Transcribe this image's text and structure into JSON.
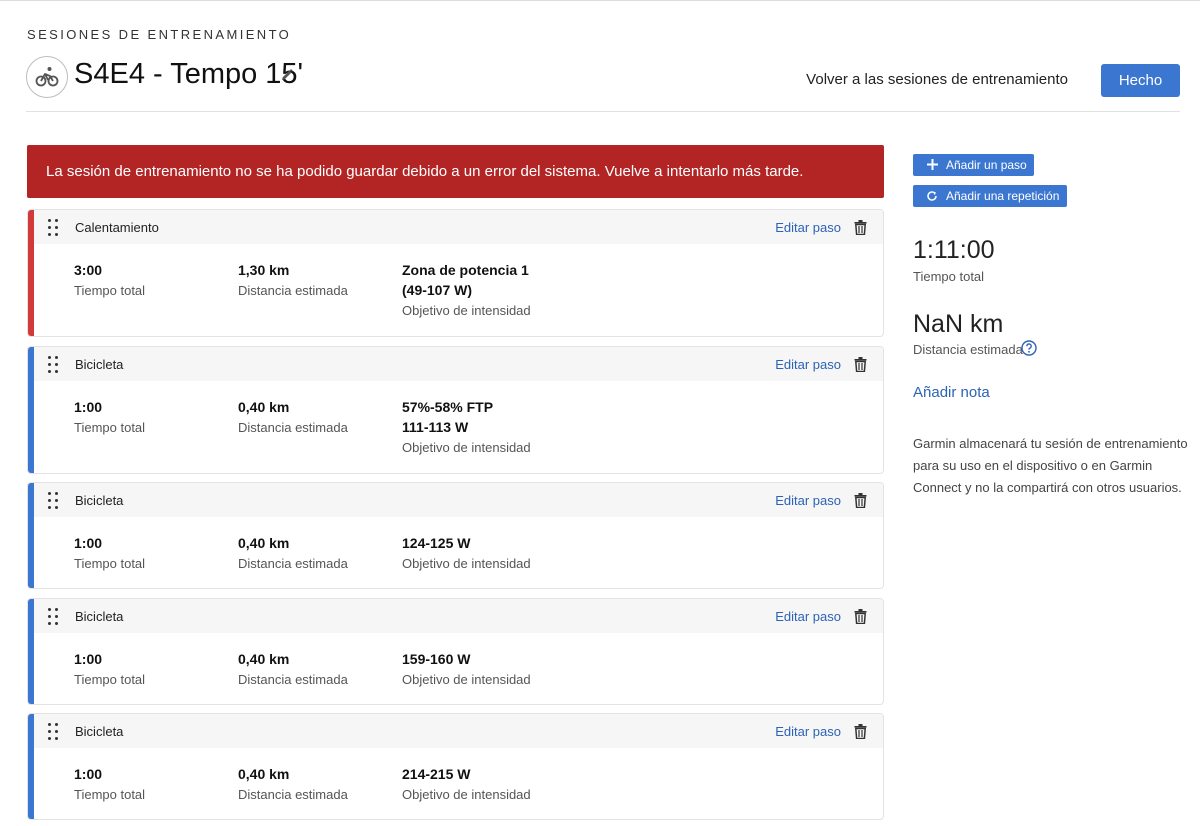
{
  "header": {
    "section_label": "SESIONES DE ENTRENAMIENTO",
    "title": "S4E4 - Tempo 15'",
    "sport_icon": "cycling-icon",
    "back_link": "Volver a las sesiones de entrenamiento",
    "done_button": "Hecho"
  },
  "error_banner": "La sesión de entrenamiento no se ha podido guardar debido a un error del sistema. Vuelve a intentarlo más tarde.",
  "colors": {
    "accent": "#3b76d1",
    "error": "#b32525",
    "warmup_stripe": "#d23a3a",
    "active_stripe": "#3b76d1",
    "link": "#2c63b6"
  },
  "steps": [
    {
      "type": "Calentamiento",
      "kind": "warmup",
      "edit_label": "Editar paso",
      "time": "3:00",
      "time_label": "Tiempo total",
      "distance": "1,30 km",
      "distance_label": "Distancia estimada",
      "target_line1": "Zona de potencia 1",
      "target_line2": "(49-107 W)",
      "target_label": "Objetivo de intensidad"
    },
    {
      "type": "Bicicleta",
      "kind": "active",
      "edit_label": "Editar paso",
      "time": "1:00",
      "time_label": "Tiempo total",
      "distance": "0,40 km",
      "distance_label": "Distancia estimada",
      "target_line1": "57%-58% FTP",
      "target_line2": "111-113 W",
      "target_label": "Objetivo de intensidad"
    },
    {
      "type": "Bicicleta",
      "kind": "active",
      "edit_label": "Editar paso",
      "time": "1:00",
      "time_label": "Tiempo total",
      "distance": "0,40 km",
      "distance_label": "Distancia estimada",
      "target_line1": "124-125 W",
      "target_line2": "",
      "target_label": "Objetivo de intensidad"
    },
    {
      "type": "Bicicleta",
      "kind": "active",
      "edit_label": "Editar paso",
      "time": "1:00",
      "time_label": "Tiempo total",
      "distance": "0,40 km",
      "distance_label": "Distancia estimada",
      "target_line1": "159-160 W",
      "target_line2": "",
      "target_label": "Objetivo de intensidad"
    },
    {
      "type": "Bicicleta",
      "kind": "active",
      "edit_label": "Editar paso",
      "time": "1:00",
      "time_label": "Tiempo total",
      "distance": "0,40 km",
      "distance_label": "Distancia estimada",
      "target_line1": "214-215 W",
      "target_line2": "",
      "target_label": "Objetivo de intensidad"
    }
  ],
  "sidebar": {
    "add_step": "Añadir un paso",
    "add_repeat": "Añadir una repetición",
    "total_time": "1:11:00",
    "total_time_label": "Tiempo total",
    "total_distance": "NaN km",
    "total_distance_label": "Distancia estimada",
    "add_note": "Añadir nota",
    "privacy_note": "Garmin almacenará tu sesión de entrenamiento para su uso en el dispositivo o en Garmin Connect y no la compartirá con otros usuarios."
  }
}
